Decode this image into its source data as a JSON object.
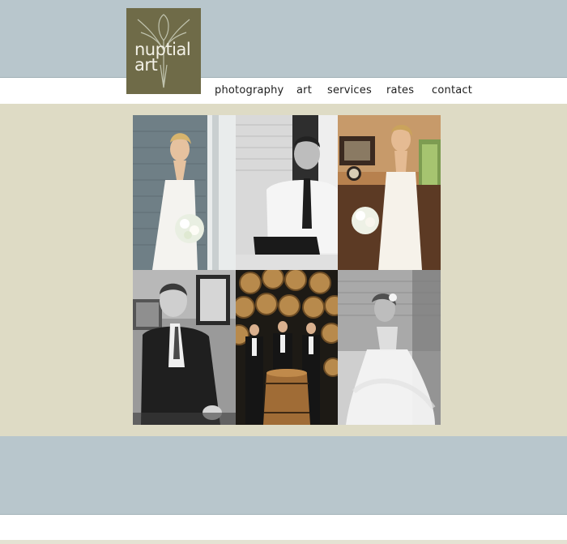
{
  "brand": {
    "line1": "nuptial",
    "line2": "art",
    "logo_color": "#6f6b48"
  },
  "nav": [
    {
      "label": "photography"
    },
    {
      "label": "art"
    },
    {
      "label": "services"
    },
    {
      "label": "rates"
    },
    {
      "label": "contact"
    }
  ],
  "colors": {
    "band_blue": "#b8c6cc",
    "content_beige": "#dedbc5"
  },
  "gallery": [
    {
      "subject": "bride-on-porch"
    },
    {
      "subject": "groom-portrait-bw"
    },
    {
      "subject": "bride-indoors"
    },
    {
      "subject": "groomsman-bw"
    },
    {
      "subject": "groomsmen-wine-barrels"
    },
    {
      "subject": "bride-motion-bw"
    }
  ]
}
